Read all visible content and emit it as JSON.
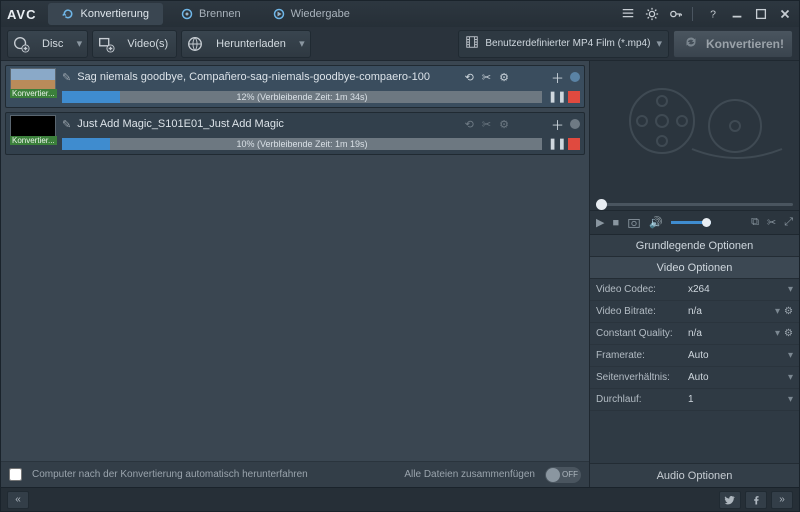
{
  "app": {
    "logo": "AVC"
  },
  "tabs": {
    "convert": "Konvertierung",
    "burn": "Brennen",
    "play": "Wiedergabe"
  },
  "toolbar": {
    "disc": "Disc",
    "videos": "Video(s)",
    "download": "Herunterladen",
    "format_label": "Benutzerdefinierter MP4 Film (*.mp4)",
    "convert_btn": "Konvertieren!"
  },
  "items": [
    {
      "title": "Sag niemals goodbye, Compañero-sag-niemals-goodbye-compaero-100",
      "tag": "Konvertier...",
      "progress_pct": 12,
      "progress_text": "12% (Verbleibende Zeit: 1m 34s)"
    },
    {
      "title": "Just Add Magic_S101E01_Just Add Magic",
      "tag": "Konvertier...",
      "progress_pct": 10,
      "progress_text": "10% (Verbleibende Zeit: 1m 19s)"
    }
  ],
  "footer": {
    "shutdown": "Computer nach der Konvertierung automatisch herunterfahren",
    "merge": "Alle Dateien zusammenfügen",
    "merge_state": "OFF"
  },
  "options": {
    "basic_header": "Grundlegende Optionen",
    "video_header": "Video Optionen",
    "audio_header": "Audio Optionen",
    "rows": [
      {
        "label": "Video Codec:",
        "value": "x264",
        "gear": false
      },
      {
        "label": "Video Bitrate:",
        "value": "n/a",
        "gear": true
      },
      {
        "label": "Constant Quality:",
        "value": "n/a",
        "gear": true
      },
      {
        "label": "Framerate:",
        "value": "Auto",
        "gear": false
      },
      {
        "label": "Seitenverhältnis:",
        "value": "Auto",
        "gear": false
      },
      {
        "label": "Durchlauf:",
        "value": "1",
        "gear": false
      }
    ]
  }
}
